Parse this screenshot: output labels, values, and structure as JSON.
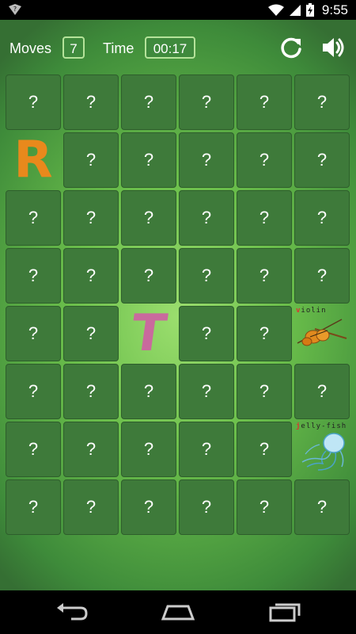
{
  "status": {
    "time": "9:55"
  },
  "header": {
    "moves_label": "Moves",
    "moves_value": "7",
    "time_label": "Time",
    "time_value": "00:17"
  },
  "grid": {
    "hidden_symbol": "?",
    "rows": 8,
    "cols": 6,
    "revealed": [
      {
        "row": 1,
        "col": 0,
        "type": "letter",
        "text": "R",
        "color": "#e8891c"
      },
      {
        "row": 4,
        "col": 2,
        "type": "letter",
        "text": "T",
        "color": "#c96a9d"
      },
      {
        "row": 4,
        "col": 5,
        "type": "picture",
        "word_first": "v",
        "word_rest": "iolin",
        "icon": "violin-icon"
      },
      {
        "row": 6,
        "col": 5,
        "type": "picture",
        "word_first": "j",
        "word_rest": "elly-fish",
        "icon": "jellyfish-icon"
      }
    ]
  },
  "colors": {
    "tile": "#3e7a3a",
    "accent_border": "#b5e39a"
  }
}
